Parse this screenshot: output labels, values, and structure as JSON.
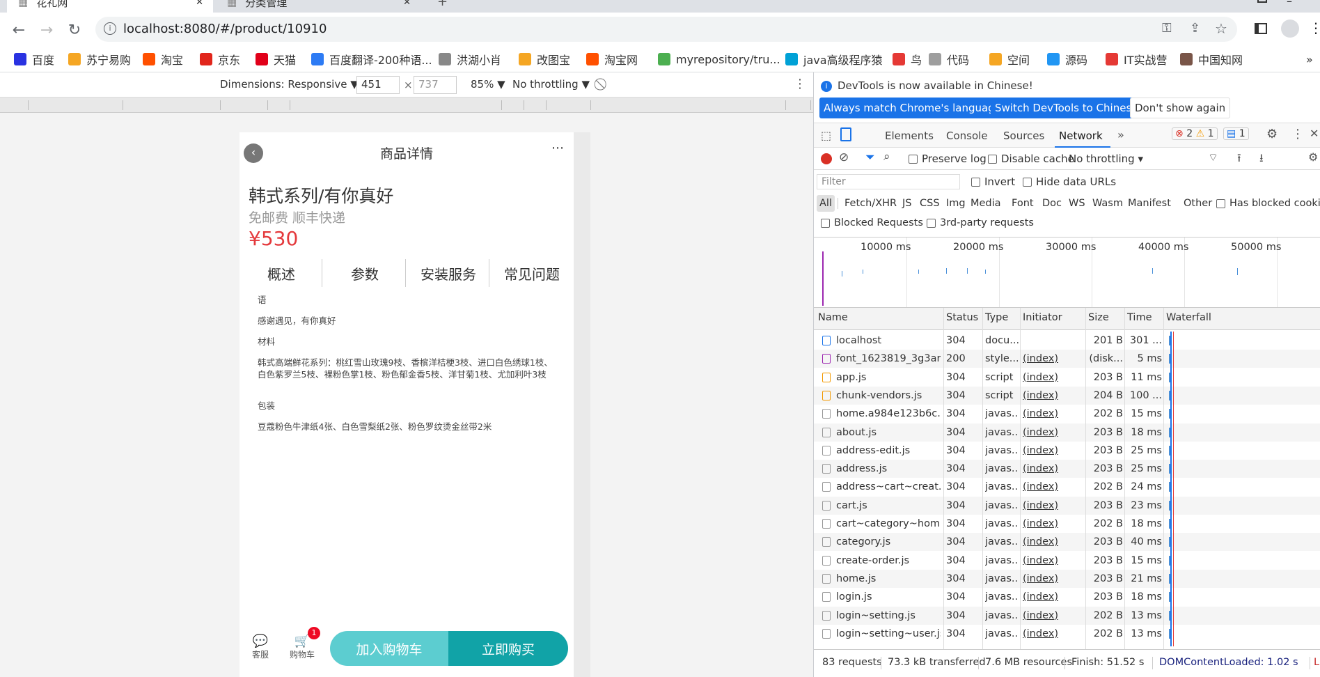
{
  "tabs": [
    {
      "label": "花礼网",
      "active": true
    },
    {
      "label": "分类管理",
      "active": false
    }
  ],
  "address": {
    "url": "localhost:8080/#/product/10910"
  },
  "bookmarks": [
    {
      "label": "百度",
      "color": "#2932e1"
    },
    {
      "label": "苏宁易购",
      "color": "#f5a623"
    },
    {
      "label": "淘宝",
      "color": "#ff5000"
    },
    {
      "label": "京东",
      "color": "#e1251b"
    },
    {
      "label": "天猫",
      "color": "#e1001a"
    },
    {
      "label": "百度翻译-200种语...",
      "color": "#2d7bf4"
    },
    {
      "label": "洪湖小肖",
      "color": "#888888"
    },
    {
      "label": "改图宝",
      "color": "#f5a623"
    },
    {
      "label": "淘宝网",
      "color": "#ff5000"
    },
    {
      "label": "myrepository/tru...",
      "color": "#4caf50"
    },
    {
      "label": "java高级程序猿",
      "color": "#00a1d6"
    },
    {
      "label": "鸟",
      "color": "#e53935"
    },
    {
      "label": "代码",
      "color": "#9e9e9e"
    },
    {
      "label": "空间",
      "color": "#f5a623"
    },
    {
      "label": "源码",
      "color": "#2196f3"
    },
    {
      "label": "IT实战营",
      "color": "#e53935"
    },
    {
      "label": "中国知网",
      "color": "#795548"
    }
  ],
  "device_toolbar": {
    "dimensions": "Dimensions: Responsive ▼",
    "width": "451",
    "height": "737",
    "zoom": "85% ▼",
    "throttling": "No throttling ▼"
  },
  "product": {
    "nav_title": "商品详情",
    "title": "韩式系列/有你真好",
    "subtitle": "免邮费 顺丰快递",
    "price": "¥530",
    "tabs": [
      "概述",
      "参数",
      "安装服务",
      "常见问题"
    ],
    "lines": [
      "语",
      "感谢遇见，有你真好",
      "材料",
      "韩式高端鲜花系列：桃红雪山玫瑰9枝、香槟洋桔梗3枝、进口白色绣球1枝、白色紫罗兰5枝、裸粉色掌1枝、粉色郁金香5枝、洋甘菊1枝、尤加利叶3枝",
      "包装",
      "豆蔻粉色牛津纸4张、白色雪梨纸2张、粉色罗纹烫金丝带2米"
    ],
    "service_label": "客服",
    "cart_label": "购物车",
    "cart_badge": "1",
    "add_cart": "加入购物车",
    "buy_now": "立即购买"
  },
  "devtools": {
    "banner": "DevTools is now available in Chinese!",
    "btn_match": "Always match Chrome's language",
    "btn_switch": "Switch DevTools to Chinese",
    "btn_dismiss": "Don't show again",
    "tabs": [
      "Elements",
      "Console",
      "Sources",
      "Network"
    ],
    "active_tab": "Network",
    "errors": "2",
    "warnings": "1",
    "messages": "1",
    "preserve_log": "Preserve log",
    "disable_cache": "Disable cache",
    "throttling": "No throttling",
    "filter_placeholder": "Filter",
    "invert": "Invert",
    "hide_data_urls": "Hide data URLs",
    "types": [
      "All",
      "Fetch/XHR",
      "JS",
      "CSS",
      "Img",
      "Media",
      "Font",
      "Doc",
      "WS",
      "Wasm",
      "Manifest",
      "Other"
    ],
    "has_blocked": "Has blocked cookie",
    "blocked_requests": "Blocked Requests",
    "third_party": "3rd-party requests",
    "timeline": [
      "10000 ms",
      "20000 ms",
      "30000 ms",
      "40000 ms",
      "50000 ms"
    ],
    "columns": [
      "Name",
      "Status",
      "Type",
      "Initiator",
      "Size",
      "Time",
      "Waterfall"
    ],
    "requests": [
      {
        "name": "localhost",
        "status": "304",
        "type": "docu...",
        "initiator": "",
        "size": "201 B",
        "time": "301 ..."
      },
      {
        "name": "font_1623819_3g3ar...",
        "status": "200",
        "type": "style...",
        "initiator": "(index)",
        "size": "(disk...",
        "time": "5 ms"
      },
      {
        "name": "app.js",
        "status": "304",
        "type": "script",
        "initiator": "(index)",
        "size": "203 B",
        "time": "11 ms"
      },
      {
        "name": "chunk-vendors.js",
        "status": "304",
        "type": "script",
        "initiator": "(index)",
        "size": "204 B",
        "time": "100 ..."
      },
      {
        "name": "home.a984e123b6c...",
        "status": "304",
        "type": "javas...",
        "initiator": "(index)",
        "size": "202 B",
        "time": "15 ms"
      },
      {
        "name": "about.js",
        "status": "304",
        "type": "javas...",
        "initiator": "(index)",
        "size": "203 B",
        "time": "18 ms"
      },
      {
        "name": "address-edit.js",
        "status": "304",
        "type": "javas...",
        "initiator": "(index)",
        "size": "203 B",
        "time": "25 ms"
      },
      {
        "name": "address.js",
        "status": "304",
        "type": "javas...",
        "initiator": "(index)",
        "size": "203 B",
        "time": "25 ms"
      },
      {
        "name": "address~cart~creat...",
        "status": "304",
        "type": "javas...",
        "initiator": "(index)",
        "size": "202 B",
        "time": "24 ms"
      },
      {
        "name": "cart.js",
        "status": "304",
        "type": "javas...",
        "initiator": "(index)",
        "size": "203 B",
        "time": "23 ms"
      },
      {
        "name": "cart~category~hom...",
        "status": "304",
        "type": "javas...",
        "initiator": "(index)",
        "size": "202 B",
        "time": "18 ms"
      },
      {
        "name": "category.js",
        "status": "304",
        "type": "javas...",
        "initiator": "(index)",
        "size": "203 B",
        "time": "40 ms"
      },
      {
        "name": "create-order.js",
        "status": "304",
        "type": "javas...",
        "initiator": "(index)",
        "size": "203 B",
        "time": "15 ms"
      },
      {
        "name": "home.js",
        "status": "304",
        "type": "javas...",
        "initiator": "(index)",
        "size": "203 B",
        "time": "21 ms"
      },
      {
        "name": "login.js",
        "status": "304",
        "type": "javas...",
        "initiator": "(index)",
        "size": "203 B",
        "time": "18 ms"
      },
      {
        "name": "login~setting.js",
        "status": "304",
        "type": "javas...",
        "initiator": "(index)",
        "size": "202 B",
        "time": "13 ms"
      },
      {
        "name": "login~setting~user.js",
        "status": "304",
        "type": "javas...",
        "initiator": "(index)",
        "size": "202 B",
        "time": "13 ms"
      }
    ],
    "status": {
      "requests": "83 requests",
      "transferred": "73.3 kB transferred",
      "resources": "7.6 MB resources",
      "finish": "Finish: 51.52 s",
      "dcl": "DOMContentLoaded: 1.02 s",
      "load": "L"
    }
  }
}
